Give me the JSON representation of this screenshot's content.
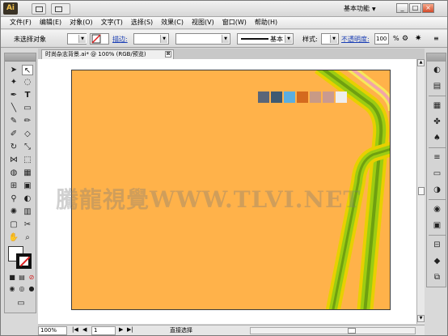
{
  "app": {
    "logo": "Ai",
    "workspace_label": "基本功能",
    "accent": "#ffb24a"
  },
  "menu": [
    "文件(F)",
    "编辑(E)",
    "对象(O)",
    "文字(T)",
    "选择(S)",
    "效果(C)",
    "视图(V)",
    "窗口(W)",
    "帮助(H)"
  ],
  "control": {
    "selection": "未选择对象",
    "stroke_link": "描边:",
    "stroke_style": "基本",
    "style_label": "样式:",
    "opacity_link": "不透明度:",
    "opacity_value": "100",
    "opacity_unit": "%"
  },
  "document": {
    "tab_title": "时尚杂志背景.ai* @ 100% (RGB/预览)",
    "close_glyph": "⊠"
  },
  "palette": [
    "#5a6678",
    "#3e5a72",
    "#5baee0",
    "#d46a1e",
    "#c89a86",
    "#c99a90",
    "#eeeeee"
  ],
  "watermark": "騰龍視覺WWW.TLVI.NET",
  "status": {
    "zoom": "100%",
    "page": "1",
    "tool": "直接选择"
  },
  "window_buttons": [
    "_",
    "□",
    "×"
  ]
}
